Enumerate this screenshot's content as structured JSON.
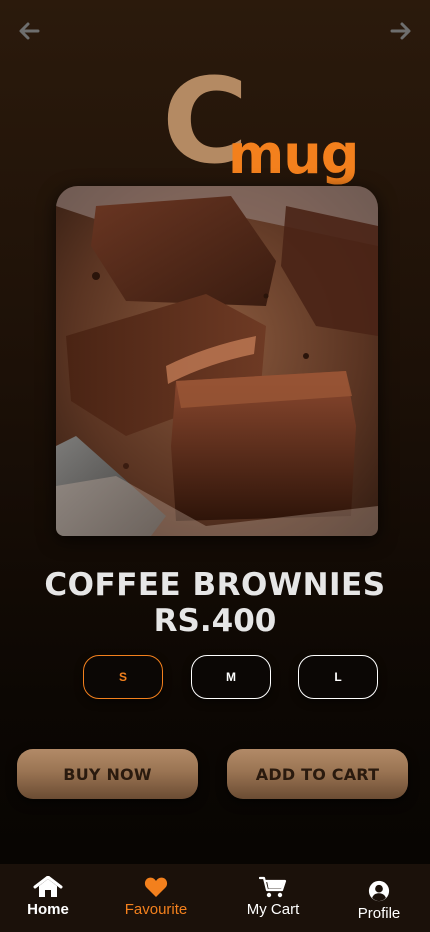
{
  "header": {
    "back_icon": "arrow-left-icon",
    "forward_icon": "arrow-right-icon",
    "logo_letter": "C",
    "logo_word": "mug"
  },
  "product": {
    "image": "chocolate-brownies-photo",
    "name": "COFFEE BROWNIES",
    "price": "RS.400"
  },
  "sizes": [
    {
      "label": "S",
      "selected": true
    },
    {
      "label": "M",
      "selected": false
    },
    {
      "label": "L",
      "selected": false
    }
  ],
  "actions": {
    "buy_now": "BUY NOW",
    "add_to_cart": "ADD TO CART"
  },
  "bottom_nav": [
    {
      "label": "Home",
      "icon": "home-icon",
      "active": false
    },
    {
      "label": "Favourite",
      "icon": "heart-icon",
      "active": true
    },
    {
      "label": "My Cart",
      "icon": "cart-icon",
      "active": false
    },
    {
      "label": "Profile",
      "icon": "user-icon",
      "active": false
    }
  ],
  "colors": {
    "accent": "#f3801d",
    "logo_brown": "#b48a63",
    "button_brown": "#9a7453",
    "background_dark": "#1c1007"
  }
}
